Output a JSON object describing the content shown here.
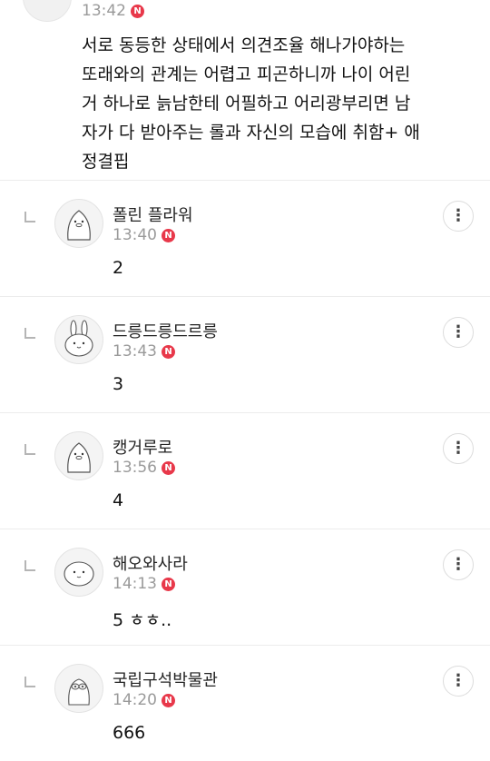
{
  "top_comment": {
    "time": "13:42",
    "badge": "N",
    "lines": [
      "서로 동등한 상태에서 의견조율 해나가야하는",
      "또래와의 관계는 어렵고 피곤하니까 나이 어린",
      "거 하나로 늙남한테 어필하고 어리광부리면 남",
      "자가 다 받아주는 롤과 자신의 모습에 취함+ 애",
      "정결핍"
    ]
  },
  "replies": [
    {
      "nickname": "폴린 플라워",
      "time": "13:40",
      "badge": "N",
      "content": "2",
      "avatar_icon": "penguin-avatar-icon"
    },
    {
      "nickname": "드릉드릉드르릉",
      "time": "13:43",
      "badge": "N",
      "content": "3",
      "avatar_icon": "bunny-avatar-icon"
    },
    {
      "nickname": "캥거루로",
      "time": "13:56",
      "badge": "N",
      "content": "4",
      "avatar_icon": "penguin-avatar-icon"
    },
    {
      "nickname": "해오와사라",
      "time": "14:13",
      "badge": "N",
      "content": "5 ㅎㅎ..",
      "avatar_icon": "round-face-avatar-icon"
    },
    {
      "nickname": "국립구석박물관",
      "time": "14:20",
      "badge": "N",
      "content": "666",
      "avatar_icon": "ghost-avatar-icon"
    }
  ],
  "icons": {
    "reply_indicator": "reply-arrow-icon",
    "more": "more-vertical-icon",
    "new_badge": "new-badge-icon"
  },
  "colors": {
    "new_badge": "#e8384a",
    "time_text": "#9a9a9a",
    "divider": "#ececec"
  }
}
